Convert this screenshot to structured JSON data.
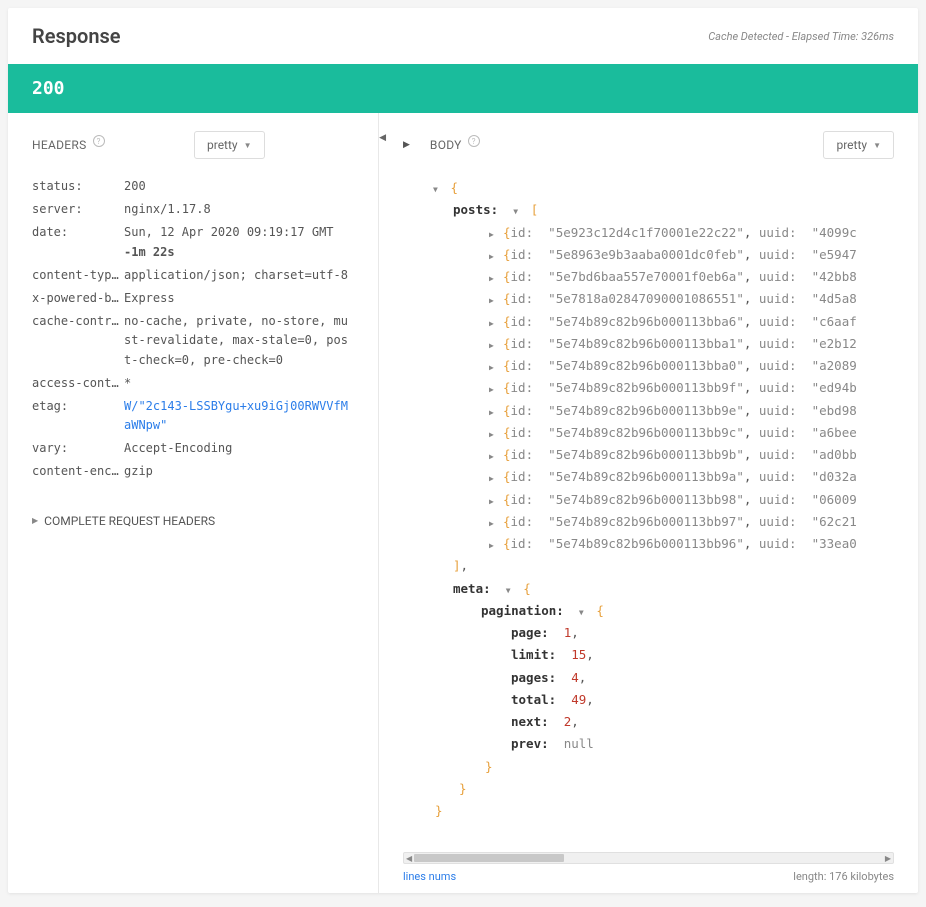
{
  "title": "Response",
  "cache_note": "Cache Detected - Elapsed Time: 326ms",
  "status_code": "200",
  "headers_panel": {
    "title": "HEADERS",
    "dropdown": "pretty",
    "complete_toggle": "COMPLETE REQUEST HEADERS",
    "rows": [
      {
        "key": "status:",
        "value": "200"
      },
      {
        "key": "server:",
        "value": "nginx/1.17.8"
      },
      {
        "key": "date:",
        "value": "Sun, 12 Apr 2020 09:19:17 GMT",
        "sub": "-1m 22s"
      },
      {
        "key": "content-typ…",
        "value": "application/json; charset=utf-8"
      },
      {
        "key": "x-powered-b…",
        "value": "Express"
      },
      {
        "key": "cache-contr…",
        "value": "no-cache, private, no-store, must-revalidate, max-stale=0, post-check=0, pre-check=0"
      },
      {
        "key": "access-cont…",
        "value": "*"
      },
      {
        "key": "etag:",
        "value": "W/\"2c143-LSSBYgu+xu9iGj00RWVVfMaWNpw\"",
        "link": true
      },
      {
        "key": "vary:",
        "value": "Accept-Encoding"
      },
      {
        "key": "content-enc…",
        "value": "gzip"
      }
    ]
  },
  "body_panel": {
    "title": "BODY",
    "dropdown": "pretty",
    "posts_key": "posts:",
    "meta_key": "meta:",
    "pagination_key": "pagination:",
    "id_label": "id:",
    "uuid_label": "uuid:",
    "posts": [
      {
        "id": "5e923c12d4c1f70001e22c22",
        "uuid": "4099c"
      },
      {
        "id": "5e8963e9b3aaba0001dc0feb",
        "uuid": "e5947"
      },
      {
        "id": "5e7bd6baa557e70001f0eb6a",
        "uuid": "42bb8"
      },
      {
        "id": "5e7818a02847090001086551",
        "uuid": "4d5a8"
      },
      {
        "id": "5e74b89c82b96b000113bba6",
        "uuid": "c6aaf"
      },
      {
        "id": "5e74b89c82b96b000113bba1",
        "uuid": "e2b12"
      },
      {
        "id": "5e74b89c82b96b000113bba0",
        "uuid": "a2089"
      },
      {
        "id": "5e74b89c82b96b000113bb9f",
        "uuid": "ed94b"
      },
      {
        "id": "5e74b89c82b96b000113bb9e",
        "uuid": "ebd98"
      },
      {
        "id": "5e74b89c82b96b000113bb9c",
        "uuid": "a6bee"
      },
      {
        "id": "5e74b89c82b96b000113bb9b",
        "uuid": "ad0bb"
      },
      {
        "id": "5e74b89c82b96b000113bb9a",
        "uuid": "d032a"
      },
      {
        "id": "5e74b89c82b96b000113bb98",
        "uuid": "06009"
      },
      {
        "id": "5e74b89c82b96b000113bb97",
        "uuid": "62c21"
      },
      {
        "id": "5e74b89c82b96b000113bb96",
        "uuid": "33ea0"
      }
    ],
    "pagination": {
      "page_k": "page:",
      "page_v": "1",
      "limit_k": "limit:",
      "limit_v": "15",
      "pages_k": "pages:",
      "pages_v": "4",
      "total_k": "total:",
      "total_v": "49",
      "next_k": "next:",
      "next_v": "2",
      "prev_k": "prev:",
      "prev_v": "null"
    },
    "footer": {
      "lines": "lines nums",
      "length": "length: 176 kilobytes"
    }
  }
}
